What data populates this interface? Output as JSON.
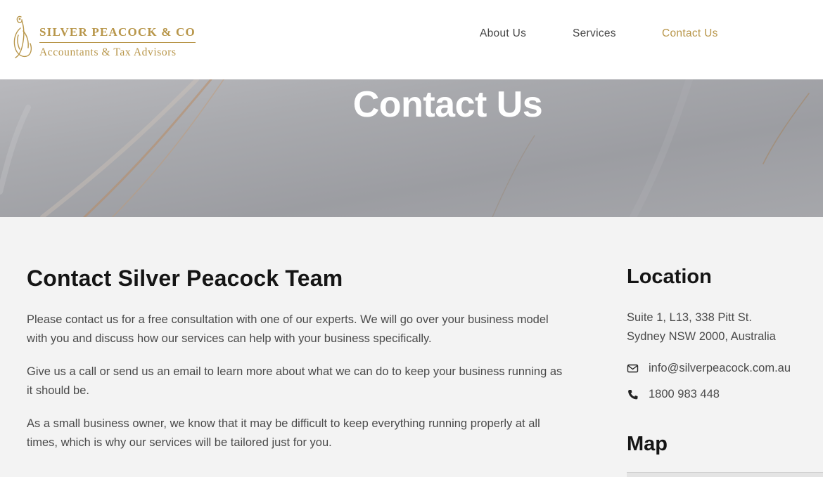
{
  "header": {
    "logo": {
      "name": "SILVER PEACOCK & CO",
      "tagline": "Accountants & Tax Advisors",
      "icon": "peacock-icon",
      "color": "#b8964a"
    },
    "nav": [
      {
        "label": "About Us",
        "active": false
      },
      {
        "label": "Services",
        "active": false
      },
      {
        "label": "Contact Us",
        "active": true
      }
    ]
  },
  "hero": {
    "title": "Contact Us"
  },
  "main": {
    "heading": "Contact Silver Peacock Team",
    "paragraphs": [
      "Please contact us for a free consultation with one of our experts. We will go over your business model with you and discuss how our services can help with your business specifically.",
      "Give us a call or send us an email to learn more about what we can do to keep your business running as it should be.",
      "As a small business owner, we know that it may be difficult to keep everything running properly at all times, which is why our services will be tailored just for you."
    ]
  },
  "sidebar": {
    "location_heading": "Location",
    "address_line1": "Suite 1, L13, 338 Pitt St.",
    "address_line2": "Sydney NSW 2000, Australia",
    "email": {
      "icon": "envelope-icon",
      "value": "info@silverpeacock.com.au"
    },
    "phone": {
      "icon": "phone-icon",
      "value": "1800 983 448"
    },
    "map_heading": "Map"
  },
  "colors": {
    "accent": "#b8964a",
    "heading": "#151515",
    "body_text": "#4a4a4a",
    "page_background": "#f3f3f3"
  }
}
